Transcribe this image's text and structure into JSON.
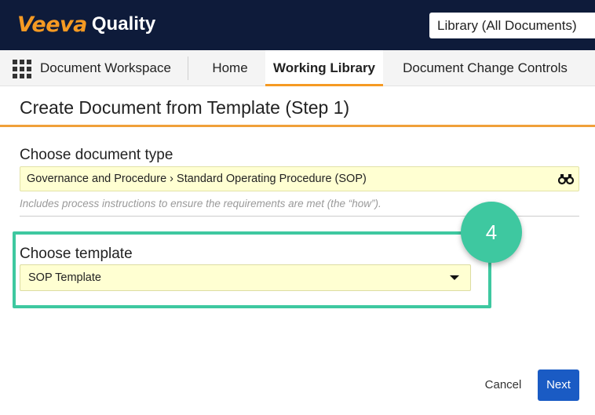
{
  "header": {
    "brand": "Veeva",
    "product": "Quality",
    "library_selector": "Library (All Documents)",
    "colors": {
      "background": "#0e1b3a",
      "brand": "#f59a23"
    }
  },
  "nav": {
    "menu_icon": "grid-icon",
    "workspace": "Document Workspace",
    "tabs": [
      {
        "label": "Home",
        "active": false
      },
      {
        "label": "Working Library",
        "active": true
      },
      {
        "label": "Document Change Controls",
        "active": false
      }
    ],
    "active_color": "#f59a23"
  },
  "page": {
    "title": "Create Document from Template (Step 1)"
  },
  "form": {
    "doc_type": {
      "label": "Choose document type",
      "value": "Governance and Procedure › Standard Operating Procedure (SOP)",
      "icon": "binoculars-icon",
      "helper": "Includes process instructions to ensure the requirements are met (the “how”)."
    },
    "template": {
      "label": "Choose template",
      "value": "SOP Template",
      "icon": "caret-down-icon"
    }
  },
  "annotation": {
    "step": "4",
    "color": "#3ec8a0"
  },
  "footer": {
    "cancel": "Cancel",
    "next": "Next",
    "next_color": "#1a5bc4"
  }
}
